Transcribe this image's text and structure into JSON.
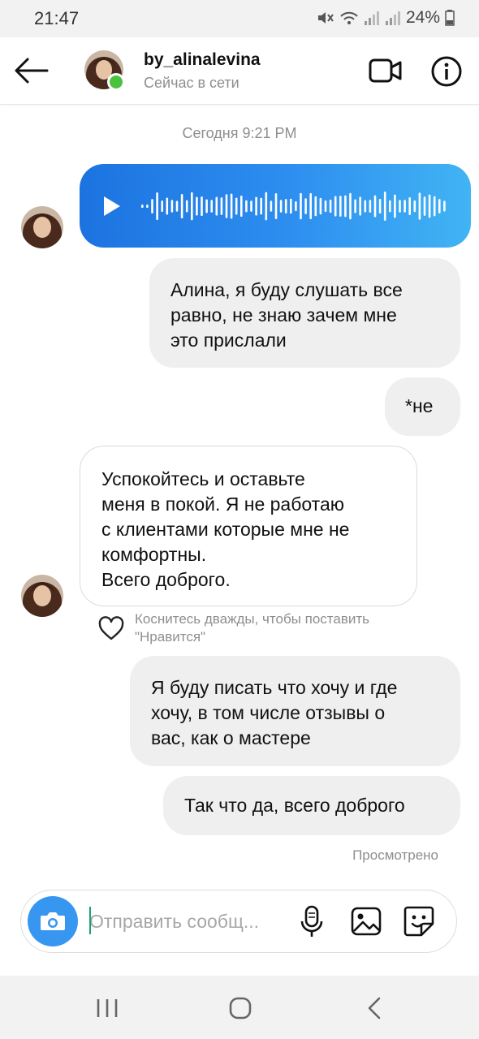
{
  "status_bar": {
    "time": "21:47",
    "battery": "24%"
  },
  "header": {
    "username": "by_alinalevina",
    "presence": "Сейчас в сети"
  },
  "timestamp": "Сегодня 9:21 PM",
  "messages": [
    {
      "kind": "voice",
      "side": "incoming"
    },
    {
      "kind": "text",
      "side": "outgoing",
      "text": "Алина, я буду слушать все\nравно, не знаю зачем мне\nэто прислали"
    },
    {
      "kind": "text",
      "side": "outgoing",
      "text": "*не"
    },
    {
      "kind": "text",
      "side": "incoming",
      "text": "Успокойтесь и оставьте\nменя в покой. Я не работаю\nс клиентами которые мне не\nкомфортны.\nВсего доброго."
    },
    {
      "kind": "text",
      "side": "outgoing",
      "text": "Я буду писать что хочу и где\nхочу, в том числе отзывы о\nвас, как о мастере"
    },
    {
      "kind": "text",
      "side": "outgoing",
      "text": "Так что да, всего доброго"
    }
  ],
  "like_hint": "Коснитесь дважды, чтобы поставить\n\"Нравится\"",
  "seen_label": "Просмотрено",
  "composer": {
    "placeholder": "Отправить сообщ..."
  },
  "icons": {
    "back": "arrow-left-icon",
    "video": "video-camera-icon",
    "info": "info-icon",
    "play": "play-icon",
    "heart": "heart-icon",
    "camera": "camera-icon",
    "mic": "microphone-icon",
    "gallery": "image-icon",
    "sticker": "sticker-icon"
  },
  "colors": {
    "accent": "#3797f0",
    "online": "#4bc23e",
    "voice_start": "#1c73e0",
    "voice_end": "#41b4f3"
  }
}
